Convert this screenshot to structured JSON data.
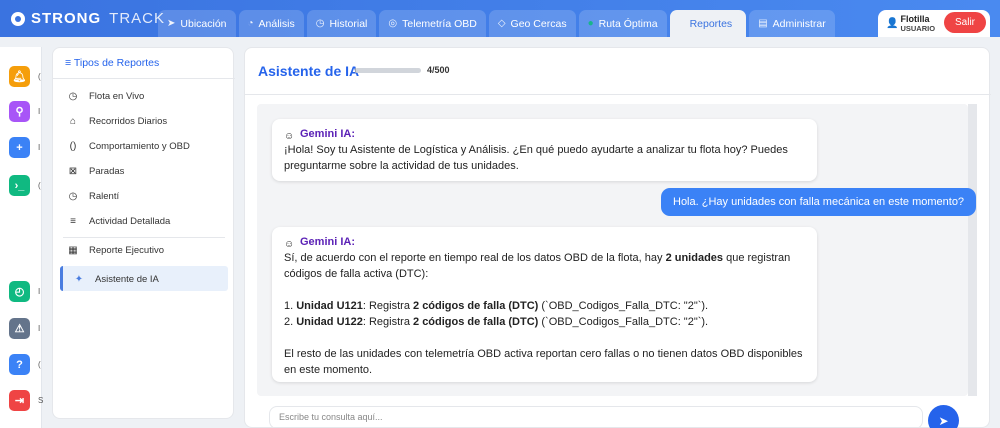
{
  "app": {
    "brand_1": "STRONG",
    "brand_2": "TRACK"
  },
  "nav": {
    "tabs": [
      {
        "label": "Ubicación",
        "icon": "send-icon"
      },
      {
        "label": "Análisis",
        "icon": "chart-icon"
      },
      {
        "label": "Historial",
        "icon": "clock-icon"
      },
      {
        "label": "Telemetría OBD",
        "icon": "obd-icon"
      },
      {
        "label": "Geo Cercas",
        "icon": "shield-icon"
      },
      {
        "label": "Ruta Óptima",
        "icon": "route-icon"
      },
      {
        "label": "Reportes",
        "icon": "report-icon",
        "active": true
      },
      {
        "label": "Administrar",
        "icon": "admin-icon"
      }
    ]
  },
  "user": {
    "name": "Flotilla",
    "role": "USUARIO",
    "logout_label": "Salir"
  },
  "rail": {
    "items": [
      {
        "icon": "bell-icon",
        "color": "#f59e0b",
        "label": "("
      },
      {
        "icon": "map-pin-icon",
        "color": "#a855f7",
        "label": "I"
      },
      {
        "icon": "add-user-icon",
        "color": "#3b82f6",
        "label": "I"
      },
      {
        "icon": "terminal-icon",
        "color": "#10b981",
        "label": "("
      },
      {
        "icon": "timer-icon",
        "color": "#10b981",
        "label": "I"
      },
      {
        "icon": "warning-icon",
        "color": "#64748b",
        "label": "I"
      },
      {
        "icon": "help-icon",
        "color": "#3b82f6",
        "label": "("
      },
      {
        "icon": "logout-icon",
        "color": "#ef4444",
        "label": "S"
      }
    ]
  },
  "reports_panel": {
    "title": "Tipos de Reportes",
    "items": [
      {
        "label": "Flota en Vivo",
        "icon": "clock-icon"
      },
      {
        "label": "Recorridos Diarios",
        "icon": "home-icon"
      },
      {
        "label": "Comportamiento y OBD",
        "icon": "bolt-icon"
      },
      {
        "label": "Paradas",
        "icon": "stop-icon"
      },
      {
        "label": "Ralentí",
        "icon": "clock-icon"
      },
      {
        "label": "Actividad Detallada",
        "icon": "list-icon"
      },
      {
        "label": "Reporte Ejecutivo",
        "icon": "layout-icon"
      },
      {
        "label": "Asistente de IA",
        "icon": "sparkle-icon",
        "active": true
      }
    ]
  },
  "assistant": {
    "title": "Asistente de IA",
    "usage": "4/500",
    "usage_fraction": 0.008,
    "input_placeholder": "Escribe tu consulta aquí...",
    "messages": {
      "bot1": {
        "sender": "Gemini IA:",
        "text": "¡Hola! Soy tu Asistente de Logística y Análisis. ¿En qué puedo ayudarte a analizar tu flota hoy? Puedes preguntarme sobre la actividad de tus unidades."
      },
      "user1": {
        "text": "Hola. ¿Hay unidades con falla mecánica en este momento?"
      },
      "bot2": {
        "sender": "Gemini IA:",
        "intro_a": "Sí, de acuerdo con el reporte en tiempo real de los datos OBD de la flota, hay ",
        "intro_bold": "2 unidades",
        "intro_b": " que registran códigos de falla activa (DTC):",
        "l1_num": "1. ",
        "l1_unit": "Unidad U121",
        "l1_mid": ": Registra ",
        "l1_bold": "2 códigos de falla (DTC)",
        "l1_end": " (`OBD_Codigos_Falla_DTC: \"2\"`).",
        "l2_num": "2. ",
        "l2_unit": "Unidad U122",
        "l2_mid": ": Registra ",
        "l2_bold": "2 códigos de falla (DTC)",
        "l2_end": " (`OBD_Codigos_Falla_DTC: \"2\"`).",
        "outro": "El resto de las unidades con telemetría OBD activa reportan cero fallas o no tienen datos OBD disponibles en este momento."
      }
    }
  }
}
